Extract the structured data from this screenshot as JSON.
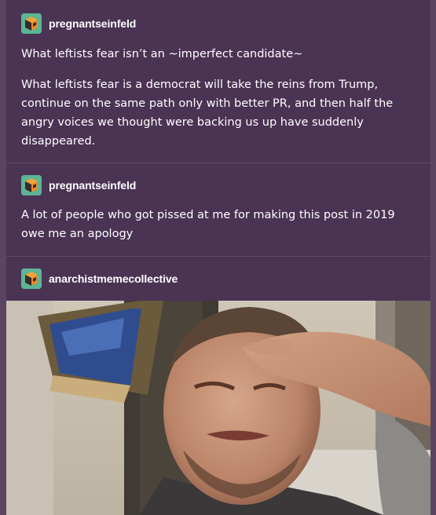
{
  "posts": [
    {
      "username": "pregnantseinfeld",
      "avatar_icon": "cube-avatar-icon",
      "paragraphs": [
        "What leftists fear isn’t an ~imperfect candidate~",
        "What leftists fear is a democrat will take the reins from Trump, continue on the same path only with better PR, and then half the angry voices we thought were backing us up have suddenly disappeared."
      ]
    },
    {
      "username": "pregnantseinfeld",
      "avatar_icon": "cube-avatar-icon",
      "paragraphs": [
        "A lot of people who got pissed at me for making this post in 2019 owe me an apology"
      ]
    },
    {
      "username": "anarchistmemecollective",
      "avatar_icon": "cube-avatar-icon",
      "image": "crying-saluting-man-photo"
    }
  ],
  "colors": {
    "background": "#4b3354",
    "divider": "#5f4a68",
    "avatar_bg": "#5cb595",
    "text": "#ffffff"
  }
}
